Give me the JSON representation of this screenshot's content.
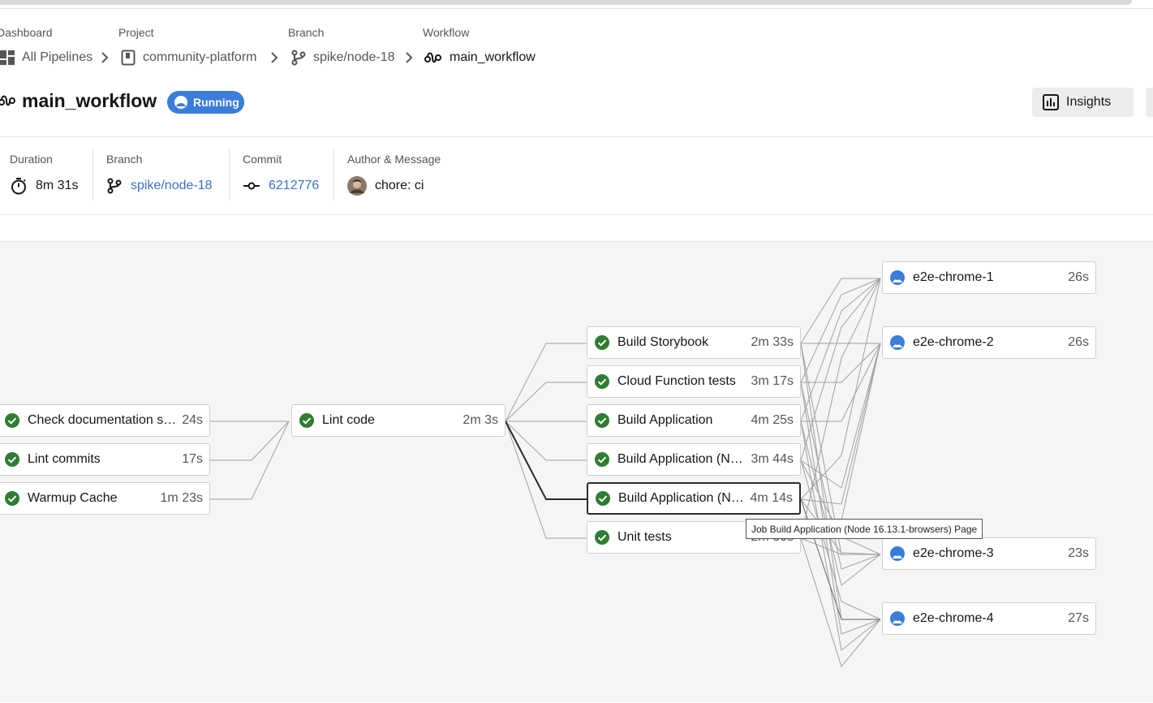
{
  "breadcrumb": {
    "dashboard": {
      "label": "Dashboard",
      "value": "All Pipelines"
    },
    "project": {
      "label": "Project",
      "value": "community-platform"
    },
    "branch": {
      "label": "Branch",
      "value": "spike/node-18"
    },
    "workflow": {
      "label": "Workflow",
      "value": "main_workflow"
    }
  },
  "header": {
    "title": "main_workflow",
    "status": "Running",
    "insights_label": "Insights"
  },
  "meta": {
    "duration": {
      "label": "Duration",
      "value": "8m 31s"
    },
    "branch": {
      "label": "Branch",
      "value": "spike/node-18"
    },
    "commit": {
      "label": "Commit",
      "value": "6212776"
    },
    "author": {
      "label": "Author & Message",
      "value": "chore: ci"
    }
  },
  "jobs": [
    {
      "name": "Check documentation sp...",
      "duration": "24s",
      "status": "success"
    },
    {
      "name": "Lint commits",
      "duration": "17s",
      "status": "success"
    },
    {
      "name": "Warmup Cache",
      "duration": "1m 23s",
      "status": "success"
    },
    {
      "name": "Lint code",
      "duration": "2m 3s",
      "status": "success"
    },
    {
      "name": "Build Storybook",
      "duration": "2m 33s",
      "status": "success"
    },
    {
      "name": "Cloud Function tests",
      "duration": "3m 17s",
      "status": "success"
    },
    {
      "name": "Build Application",
      "duration": "4m 25s",
      "status": "success"
    },
    {
      "name": "Build Application (No...",
      "duration": "3m 44s",
      "status": "success"
    },
    {
      "name": "Build Application (No...",
      "duration": "4m 14s",
      "status": "success"
    },
    {
      "name": "Unit tests",
      "duration": "2m 30s",
      "status": "success"
    },
    {
      "name": "e2e-chrome-1",
      "duration": "26s",
      "status": "running"
    },
    {
      "name": "e2e-chrome-2",
      "duration": "26s",
      "status": "running"
    },
    {
      "name": "e2e-chrome-3",
      "duration": "23s",
      "status": "running"
    },
    {
      "name": "e2e-chrome-4",
      "duration": "27s",
      "status": "running"
    }
  ],
  "tooltip": "Job Build Application (Node 16.13.1-browsers) Page",
  "colors": {
    "success": "#2e7d32",
    "running": "#3b7dd8",
    "link": "#3b6fc9",
    "graph_bg": "#f5f5f5"
  }
}
